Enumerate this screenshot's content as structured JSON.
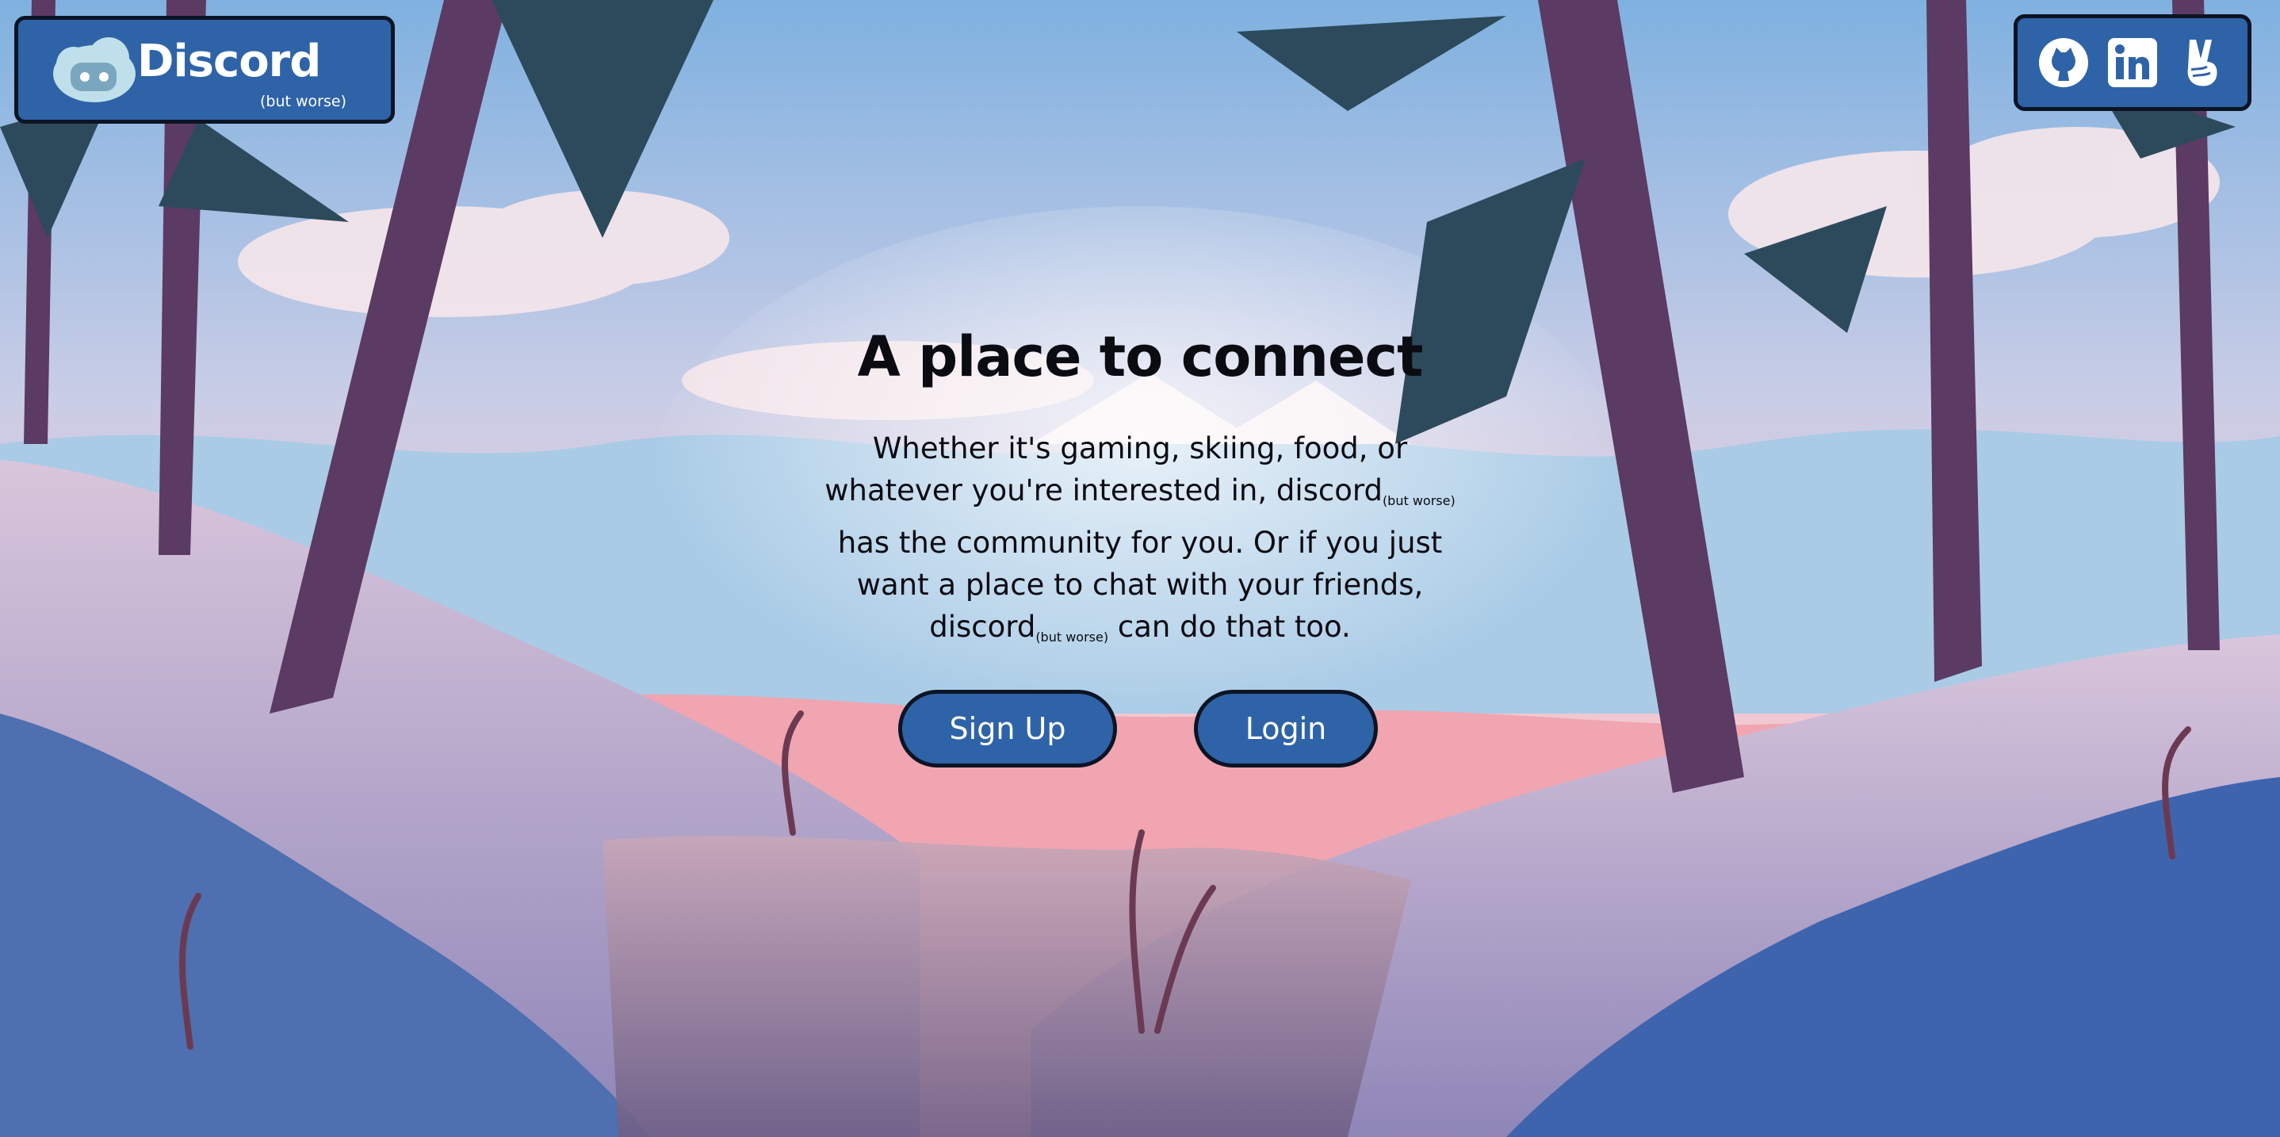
{
  "brand": {
    "title": "Discord",
    "subtitle": "(but worse)"
  },
  "social": {
    "links": [
      {
        "icon": "github-icon"
      },
      {
        "icon": "linkedin-icon"
      },
      {
        "icon": "peace-hand-icon"
      }
    ]
  },
  "hero": {
    "title": "A place to connect",
    "line1": "Whether it's gaming, skiing, food, or",
    "line2_before": "whatever you're interested in, discord",
    "line2_small": "(but worse)",
    "line3": "has the community for you. Or if you just",
    "line4": "want a place to chat with your friends,",
    "line5_before": "discord",
    "line5_small": "(but worse)",
    "line5_after": " can do that too."
  },
  "actions": {
    "signup_label": "Sign Up",
    "login_label": "Login"
  },
  "colors": {
    "button_blue": "#2f63a8",
    "outline": "#0c1424",
    "text": "#0b0b12"
  }
}
